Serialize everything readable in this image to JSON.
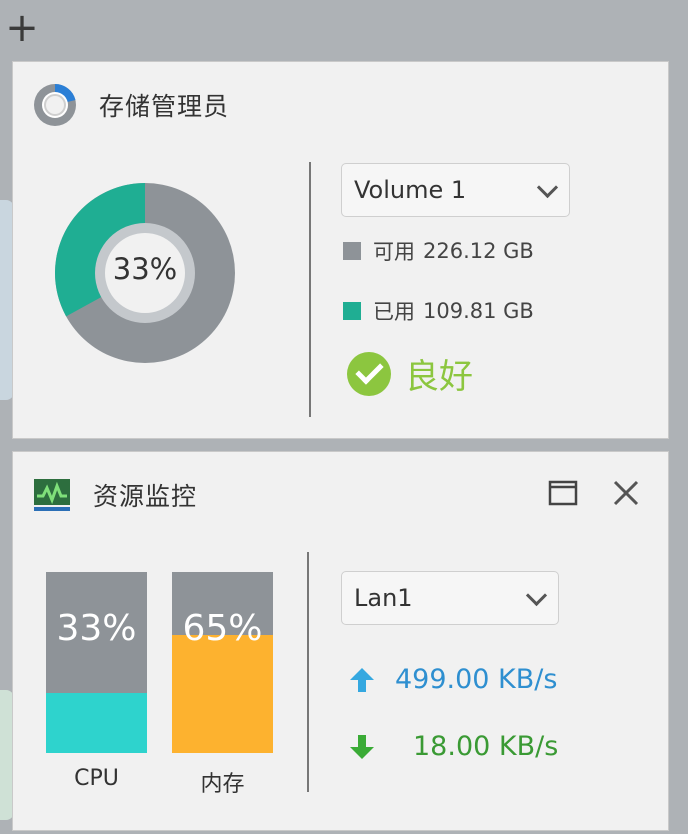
{
  "add_label": "+",
  "storage": {
    "title": "存储管理员",
    "usage_percent_label": "33%",
    "used_fraction": 0.33,
    "volume_select": "Volume 1",
    "available_label": "可用",
    "available_value": "226.12 GB",
    "used_label": "已用",
    "used_value": "109.81 GB",
    "status_text": "良好",
    "colors": {
      "used": "#1fae93",
      "available": "#8e9398",
      "status": "#8cc63f",
      "icon_accent": "#2b7fd6"
    }
  },
  "resource": {
    "title": "资源监控",
    "cpu": {
      "label": "CPU",
      "percent_label": "33%",
      "fraction": 0.33,
      "color": "#2ed3cd"
    },
    "memory": {
      "label": "内存",
      "percent_label": "65%",
      "fraction": 0.65,
      "color": "#fdb22f"
    },
    "network_select": "Lan1",
    "upload_rate": "499.00 KB/s",
    "download_rate": "18.00 KB/s",
    "colors": {
      "upload": "#2e8fd0",
      "download": "#3a9a34",
      "upload_arrow": "#35a8e0",
      "download_arrow": "#3aab36"
    }
  }
}
